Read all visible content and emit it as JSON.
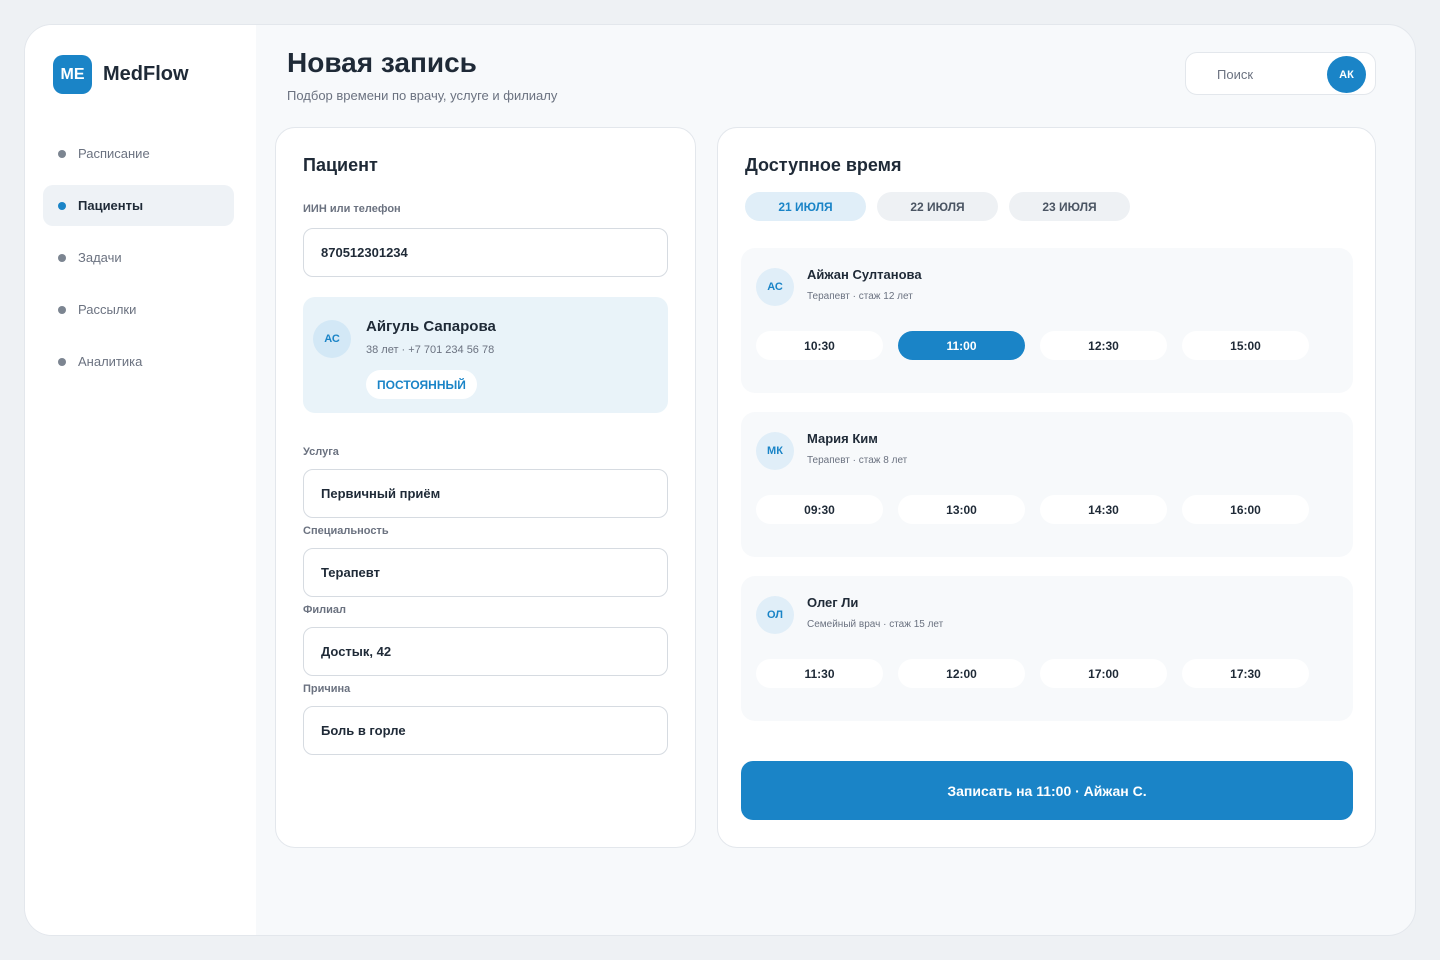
{
  "app": {
    "logo_mark": "ME",
    "name": "MedFlow"
  },
  "nav": [
    {
      "label": "Расписание"
    },
    {
      "label": "Пациенты",
      "active": true
    },
    {
      "label": "Задачи"
    },
    {
      "label": "Рассылки"
    },
    {
      "label": "Аналитика"
    }
  ],
  "header": {
    "title": "Новая запись",
    "subtitle": "Подбор времени по врачу, услуге и филиалу",
    "search_placeholder": "Поиск",
    "user_initials": "АК"
  },
  "patient_card": {
    "title": "Пациент",
    "id_label": "ИИН или телефон",
    "id_value": "870512301234",
    "patient": {
      "initials": "АС",
      "name": "Айгуль Сапарова",
      "meta": "38 лет · +7 701 234 56 78",
      "badge": "ПОСТОЯННЫЙ"
    },
    "fields": [
      {
        "label": "Услуга",
        "value": "Первичный приём"
      },
      {
        "label": "Специальность",
        "value": "Терапевт"
      },
      {
        "label": "Филиал",
        "value": "Достык, 42"
      },
      {
        "label": "Причина",
        "value": "Боль в горле"
      }
    ]
  },
  "time_card": {
    "title": "Доступное время",
    "dates": [
      "21 ИЮЛЯ",
      "22 ИЮЛЯ",
      "23 ИЮЛЯ"
    ],
    "active_date": 0,
    "doctors": [
      {
        "initials": "АС",
        "name": "Айжан Султанова",
        "meta": "Терапевт · стаж 12 лет",
        "slots": [
          "10:30",
          "11:00",
          "12:30",
          "15:00"
        ],
        "selected_slot": 1
      },
      {
        "initials": "МК",
        "name": "Мария Ким",
        "meta": "Терапевт · стаж 8 лет",
        "slots": [
          "09:30",
          "13:00",
          "14:30",
          "16:00"
        ],
        "selected_slot": -1
      },
      {
        "initials": "ОЛ",
        "name": "Олег Ли",
        "meta": "Семейный врач · стаж 15 лет",
        "slots": [
          "11:30",
          "12:00",
          "17:00",
          "17:30"
        ],
        "selected_slot": -1
      }
    ],
    "cta_label": "Записать на 11:00 · Айжан С."
  },
  "colors": {
    "accent": "#1a84c7",
    "background": "#eef1f4",
    "patient_box": "#e9f3f9"
  }
}
